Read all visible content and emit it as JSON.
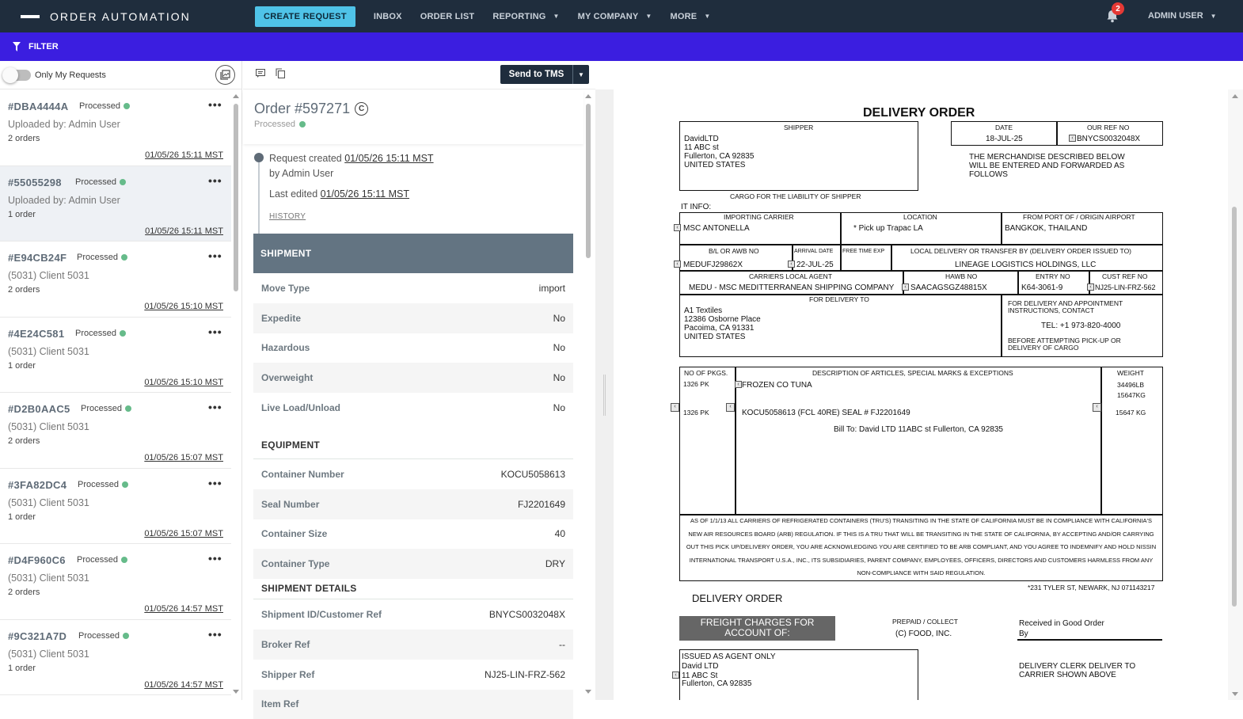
{
  "nav": {
    "brand": "ORDER AUTOMATION",
    "create_request": "CREATE REQUEST",
    "items": [
      "INBOX",
      "ORDER LIST",
      "REPORTING",
      "MY COMPANY",
      "MORE"
    ],
    "notification_count": "2",
    "user": "ADMIN USER"
  },
  "filter": {
    "label": "FILTER"
  },
  "left": {
    "toggle_label": "Only My Requests",
    "requests": [
      {
        "id": "#DBA4444A",
        "status": "Processed",
        "line1": "Uploaded by: Admin User",
        "line2": "2 orders",
        "date": "01/05/26 15:11 MST"
      },
      {
        "id": "#55055298",
        "status": "Processed",
        "line1": "Uploaded by: Admin User",
        "line2": "1 order",
        "date": "01/05/26 15:11 MST"
      },
      {
        "id": "#E94CB24F",
        "status": "Processed",
        "line1": "(5031) Client 5031",
        "line2": "2 orders",
        "date": "01/05/26 15:10 MST"
      },
      {
        "id": "#4E24C581",
        "status": "Processed",
        "line1": "(5031) Client 5031",
        "line2": "1 order",
        "date": "01/05/26 15:10 MST"
      },
      {
        "id": "#D2B0AAC5",
        "status": "Processed",
        "line1": "(5031) Client 5031",
        "line2": "2 orders",
        "date": "01/05/26 15:07 MST"
      },
      {
        "id": "#3FA82DC4",
        "status": "Processed",
        "line1": "(5031) Client 5031",
        "line2": "1 order",
        "date": "01/05/26 15:07 MST"
      },
      {
        "id": "#D4F960C6",
        "status": "Processed",
        "line1": "(5031) Client 5031",
        "line2": "2 orders",
        "date": "01/05/26 14:57 MST"
      },
      {
        "id": "#9C321A7D",
        "status": "Processed",
        "line1": "(5031) Client 5031",
        "line2": "1 order",
        "date": "01/05/26 14:57 MST"
      }
    ]
  },
  "order": {
    "send_button": "Send to TMS",
    "title": "Order #597271",
    "status": "Processed",
    "created_label": "Request created",
    "created_date": "01/05/26 15:11 MST",
    "created_by": "by Admin User",
    "edited_label": "Last edited",
    "edited_date": "01/05/26 15:11 MST",
    "history": "HISTORY",
    "section": "SHIPMENT",
    "shipment": [
      {
        "k": "Move Type",
        "v": "import"
      },
      {
        "k": "Expedite",
        "v": "No"
      },
      {
        "k": "Hazardous",
        "v": "No"
      },
      {
        "k": "Overweight",
        "v": "No"
      },
      {
        "k": "Live Load/Unload",
        "v": "No"
      }
    ],
    "equipment_header": "EQUIPMENT",
    "equipment": [
      {
        "k": "Container Number",
        "v": "KOCU5058613"
      },
      {
        "k": "Seal Number",
        "v": "FJ2201649"
      },
      {
        "k": "Container Size",
        "v": "40"
      },
      {
        "k": "Container Type",
        "v": "DRY"
      }
    ],
    "details_header": "SHIPMENT DETAILS",
    "details": [
      {
        "k": "Shipment ID/Customer Ref",
        "v": "BNYCS0032048X"
      },
      {
        "k": "Broker Ref",
        "v": "--"
      },
      {
        "k": "Shipper Ref",
        "v": "NJ25-LIN-FRZ-562"
      },
      {
        "k": "Item Ref",
        "v": ""
      }
    ]
  },
  "doc": {
    "title": "DELIVERY ORDER",
    "shipper_label": "SHIPPER",
    "shipper": [
      "DavidLTD",
      "11 ABC st",
      "Fullerton, CA 92835",
      "UNITED STATES"
    ],
    "date_label": "DATE",
    "date": "18-JUL-25",
    "our_ref_label": "OUR REF NO",
    "our_ref": "BNYCS0032048X",
    "merch_text": [
      "THE MERCHANDISE DESCRIBED BELOW",
      "WILL BE ENTERED AND FORWARDED AS",
      "FOLLOWS"
    ],
    "cargo_liability": "CARGO FOR THE LIABILITY OF SHIPPER",
    "it_info": "IT INFO:",
    "importing_carrier_label": "IMPORTING CARRIER",
    "importing_carrier": "MSC ANTONELLA",
    "location_label": "LOCATION",
    "location": "* Pick up  Trapac LA",
    "port_label": "FROM PORT OF / ORIGIN AIRPORT",
    "port": "BANGKOK, THAILAND",
    "bl_label": "B/L OR AWB NO",
    "bl": "MEDUFJ29862X",
    "arrival_label": "ARRIVAL DATE",
    "arrival": "22-JUL-25",
    "free_time_label": "FREE TIME EXP",
    "local_delivery_label": "LOCAL DELIVERY OR TRANSFER BY (DELIVERY ORDER ISSUED TO)",
    "local_delivery": "LINEAGE LOGISTICS HOLDINGS, LLC",
    "carriers_agent_label": "CARRIERS LOCAL AGENT",
    "carriers_agent": "MEDU - MSC MEDITTERRANEAN SHIPPING COMPANY",
    "hawb_label": "HAWB NO",
    "hawb": "SAACAGSGZ48815X",
    "entry_label": "ENTRY NO",
    "entry": "K64-3061-9",
    "cust_ref_label": "CUST REF NO",
    "cust_ref": "NJ25-LIN-FRZ-562",
    "for_delivery_label": "FOR DELIVERY TO",
    "delivery_to": [
      "A1 Textiles",
      "12386 Osborne Place",
      "Pacoima, CA 91331",
      "UNITED STATES"
    ],
    "appt_label": [
      "FOR DELIVERY AND APPOINTMENT",
      "INSTRUCTIONS, CONTACT"
    ],
    "tel": "TEL: +1 973-820-4000",
    "before_text": [
      "BEFORE ATTEMPTING PICK-UP OR",
      "DELIVERY OF CARGO"
    ],
    "pkgs_label": "NO OF PKGS.",
    "pkgs": "1326 PK",
    "pkgs2": "1326 PK",
    "desc_label": "DESCRIPTION OF ARTICLES, SPECIAL MARKS & EXCEPTIONS",
    "desc1": "FROZEN CO TUNA",
    "desc2": "KOCU5058613  (FCL 40RE) SEAL # FJ2201649",
    "desc3": "Bill To: David LTD 11ABC st Fullerton, CA 92835",
    "weight_label": "WEIGHT",
    "weight1": "34496LB",
    "weight2": "15647KG",
    "weight3": "15647 KG",
    "legal": "AS OF 1/1/13 ALL CARRIERS OF REFRIGERATED CONTAINERS (TRU'S) TRANSITING IN THE STATE OF CALIFORNIA MUST BE IN COMPLIANCE WITH CALIFORNIA'S NEW AIR RESOURCES BOARD (ARB) REGULATION. IF THIS IS A TRU THAT WILL BE TRANSITING IN THE STATE OF CALIFORNIA, BY ACCEPTING AND/OR CARRYING OUT THIS PICK UP/DELIVERY ORDER, YOU ARE ACKNOWLEDGING YOU ARE CERTIFIED TO BE ARB COMPLIANT, AND YOU AGREE TO INDEMNIFY AND HOLD NISSIN INTERNATIONAL TRANSPORT U.S.A., INC., ITS SUBSIDIARIES, PARENT COMPANY, EMPLOYEES, OFFICERS, DIRECTORS AND CUSTOMERS HARMLESS FROM ANY NON-COMPLIANCE WITH SAID REGULATION.",
    "address_note": "*231 TYLER ST, NEWARK, NJ 071143217",
    "footer_title": "DELIVERY ORDER",
    "freight": [
      "FREIGHT CHARGES FOR",
      "ACCOUNT OF:"
    ],
    "prepaid": "PREPAID / COLLECT",
    "food": "(C)  FOOD, INC.",
    "received": "Received in Good Order",
    "by": "By",
    "issued": [
      "ISSUED AS AGENT ONLY",
      "David LTD",
      "11 ABC St",
      "Fullerton, CA 92835"
    ],
    "clerk": [
      "DELIVERY CLERK DELIVER TO",
      "CARRIER SHOWN ABOVE"
    ]
  }
}
